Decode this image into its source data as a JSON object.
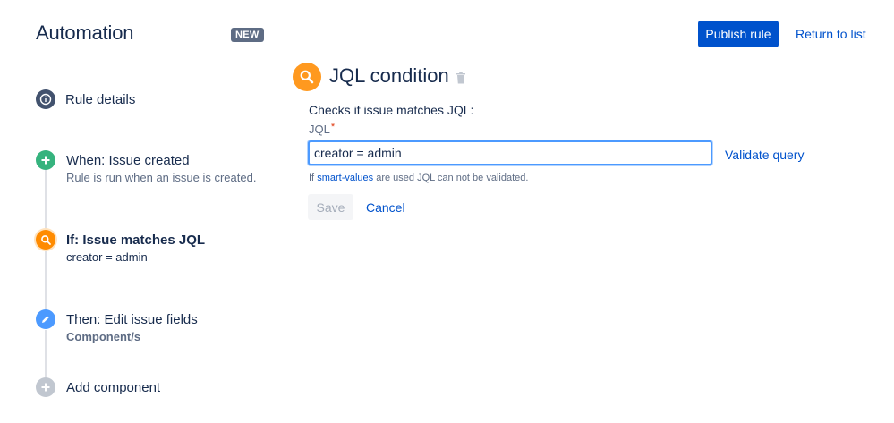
{
  "header": {
    "title": "Automation",
    "badge": "NEW",
    "publish_label": "Publish rule",
    "return_label": "Return to list"
  },
  "sidebar": {
    "rule_details": {
      "label": "Rule details",
      "icon": "info-icon"
    },
    "steps": [
      {
        "label": "When: Issue created",
        "sub": "Rule is run when an issue is created.",
        "icon": "plus-icon",
        "color": "#36b37e"
      },
      {
        "label": "If: Issue matches JQL",
        "sub": "creator = admin",
        "icon": "search-icon",
        "color": "#ff8b00",
        "active": true
      },
      {
        "label": "Then: Edit issue fields",
        "sub": "Component/s",
        "icon": "pencil-icon",
        "color": "#4c9aff"
      },
      {
        "label": "Add component",
        "icon": "plus-icon",
        "color": "#c1c7d0"
      }
    ]
  },
  "main": {
    "title": "JQL condition",
    "description": "Checks if issue matches JQL:",
    "field_label": "JQL",
    "required_mark": "*",
    "input_value": "creator = admin",
    "validate_label": "Validate query",
    "hint_prefix": "If",
    "hint_link": "smart-values",
    "hint_suffix": "are used JQL can not be validated.",
    "save_label": "Save",
    "cancel_label": "Cancel"
  },
  "colors": {
    "primary": "#0052cc",
    "text": "#172b4d",
    "subtle": "#5e6c84",
    "focus": "#4c9aff",
    "condition": "#ff991f"
  }
}
